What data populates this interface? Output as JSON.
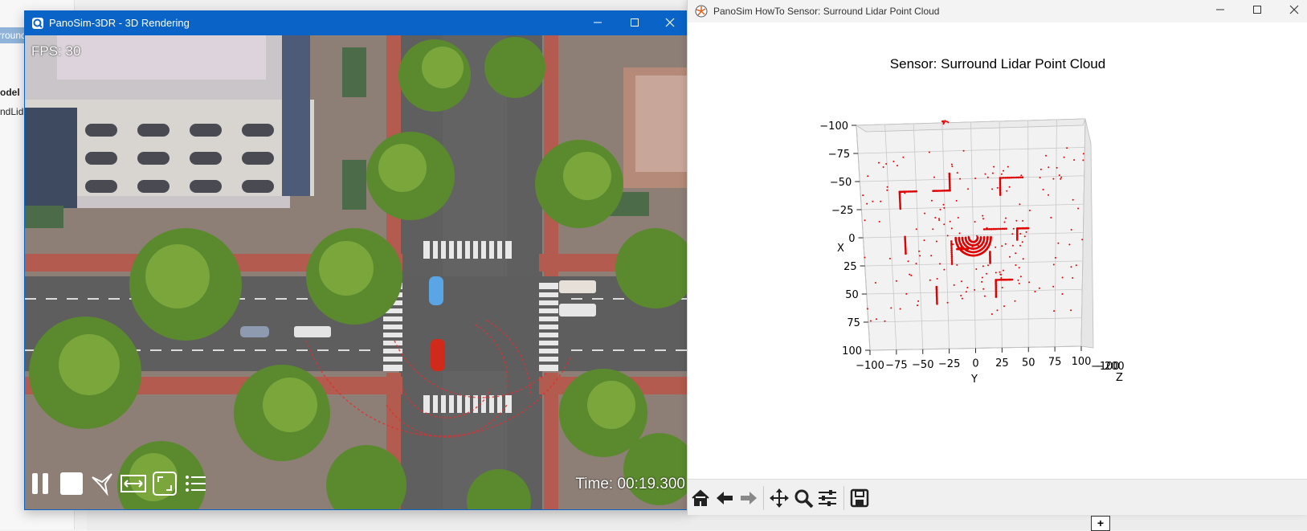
{
  "background": {
    "tab_label": "rround",
    "item1": "odel",
    "item2": "ndLid",
    "plus": "+"
  },
  "render_window": {
    "title": "PanoSim-3DR - 3D Rendering",
    "fps": "FPS: 30",
    "time": "Time: 00:19.300",
    "controls": [
      "pause-icon",
      "stop-icon",
      "drone-icon",
      "fit-width-icon",
      "fullscreen-icon",
      "list-icon"
    ]
  },
  "plot_window": {
    "title": "PanoSim HowTo Sensor: Surround Lidar Point Cloud",
    "toolbar": [
      "home-icon",
      "back-icon",
      "forward-icon",
      "pan-icon",
      "zoom-icon",
      "configure-icon",
      "save-icon"
    ]
  },
  "chart_data": {
    "type": "scatter",
    "title": "Sensor: Surround Lidar Point Cloud",
    "xlabel": "Y",
    "ylabel": "X",
    "zlabel": "Z",
    "x_ticks": [
      "−100",
      "−75",
      "−50",
      "−25",
      "0",
      "25",
      "50",
      "75",
      "100"
    ],
    "y_ticks": [
      "−100",
      "−75",
      "−50",
      "−25",
      "0",
      "25",
      "50",
      "75",
      "100"
    ],
    "z_ticks": [
      "−100",
      "−200"
    ],
    "xlim": [
      -100,
      100
    ],
    "ylim": [
      -100,
      100
    ],
    "grid": true,
    "point_color": "#e00000"
  }
}
